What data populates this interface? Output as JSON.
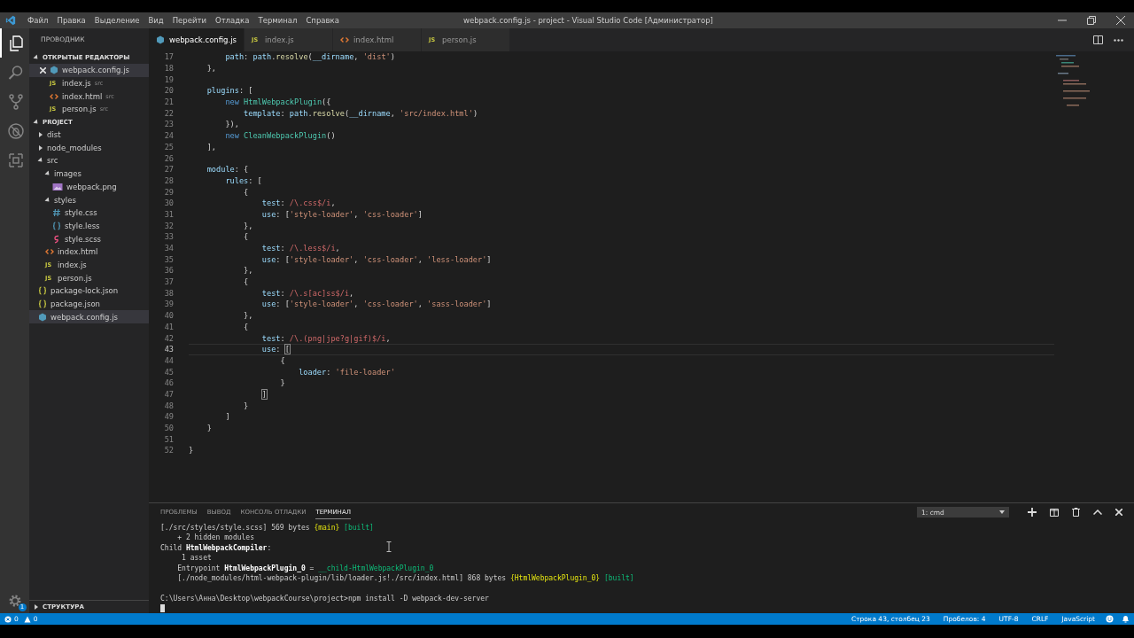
{
  "window": {
    "title": "webpack.config.js - project - Visual Studio Code [Администратор]"
  },
  "menu": [
    "Файл",
    "Правка",
    "Выделение",
    "Вид",
    "Перейти",
    "Отладка",
    "Терминал",
    "Справка"
  ],
  "activity_bar": {
    "items": [
      {
        "kind": "files",
        "selected": true
      },
      {
        "kind": "search",
        "selected": false
      },
      {
        "kind": "source-control",
        "selected": false
      },
      {
        "kind": "debug",
        "selected": false
      },
      {
        "kind": "extensions",
        "selected": false
      }
    ],
    "settings_badge": "1"
  },
  "sidebar": {
    "title": "ПРОВОДНИК",
    "sections": [
      {
        "title": "ОТКРЫТЫЕ РЕДАКТОРЫ",
        "expanded": true,
        "kind": "open-editors",
        "items": [
          {
            "name": "webpack.config.js",
            "kind": "webpack",
            "selected": true
          },
          {
            "name": "index.js",
            "dir": "src",
            "kind": "js",
            "badge": "JS",
            "selected": false
          },
          {
            "name": "index.html",
            "dir": "src",
            "kind": "html",
            "selected": false
          },
          {
            "name": "person.js",
            "dir": "src",
            "kind": "js",
            "badge": "JS",
            "selected": false
          }
        ]
      },
      {
        "title": "PROJECT",
        "expanded": true,
        "kind": "tree",
        "items": [
          {
            "name": "dist",
            "kind": "folder",
            "expanded": false,
            "selected": false
          },
          {
            "name": "node_modules",
            "kind": "folder",
            "expanded": false,
            "selected": false
          },
          {
            "name": "src",
            "kind": "folder",
            "expanded": true,
            "selected": false,
            "children": [
              {
                "name": "images",
                "kind": "folder",
                "expanded": true,
                "selected": false,
                "children": [
                  {
                    "name": "webpack.png",
                    "kind": "image",
                    "selected": false
                  }
                ]
              },
              {
                "name": "styles",
                "kind": "folder",
                "expanded": true,
                "selected": false,
                "children": [
                  {
                    "name": "style.css",
                    "kind": "css",
                    "selected": false
                  },
                  {
                    "name": "style.less",
                    "kind": "less",
                    "selected": false
                  },
                  {
                    "name": "style.scss",
                    "kind": "scss",
                    "selected": false
                  }
                ]
              },
              {
                "name": "index.html",
                "kind": "html",
                "selected": false
              },
              {
                "name": "index.js",
                "kind": "js",
                "badge": "JS",
                "selected": false
              },
              {
                "name": "person.js",
                "kind": "js",
                "badge": "JS",
                "selected": false
              }
            ]
          },
          {
            "name": "package-lock.json",
            "kind": "json",
            "selected": false
          },
          {
            "name": "package.json",
            "kind": "json",
            "selected": false
          },
          {
            "name": "webpack.config.js",
            "kind": "webpack",
            "selected": true
          }
        ]
      },
      {
        "title": "СТРУКТУРА",
        "expanded": false,
        "kind": "outline"
      }
    ]
  },
  "tabs": [
    {
      "label": "webpack.config.js",
      "kind": "webpack",
      "selected": true
    },
    {
      "label": "index.js",
      "kind": "js",
      "badge": "JS",
      "selected": false
    },
    {
      "label": "index.html",
      "kind": "html",
      "selected": false
    },
    {
      "label": "person.js",
      "kind": "js",
      "badge": "JS",
      "selected": false
    }
  ],
  "editor": {
    "lines": [
      {
        "children": [
          {
            "children": [
              {
                "number": "17",
                "current": false,
                "segments": [
                  {
                    "kind": "prop",
                    "text": "path"
                  },
                  {
                    "kind": "plain",
                    "text": ": "
                  },
                  {
                    "kind": "prop",
                    "text": "path"
                  },
                  {
                    "kind": "plain",
                    "text": "."
                  },
                  {
                    "kind": "fn",
                    "text": "resolve"
                  },
                  {
                    "kind": "plain",
                    "text": "("
                  },
                  {
                    "kind": "prop",
                    "text": "__dirname"
                  },
                  {
                    "kind": "plain",
                    "text": ", "
                  },
                  {
                    "kind": "str",
                    "text": "'dist'"
                  },
                  {
                    "kind": "plain",
                    "text": ")"
                  }
                ]
              }
            ]
          },
          {
            "number": "18",
            "current": false,
            "segments": [
              {
                "kind": "plain",
                "text": "},"
              }
            ]
          },
          {
            "number": "19",
            "current": false
          },
          {
            "number": "20",
            "current": false,
            "segments": [
              {
                "kind": "prop",
                "text": "plugins"
              },
              {
                "kind": "plain",
                "text": ": ["
              }
            ],
            "children": [
              {
                "number": "21",
                "current": false,
                "segments": [
                  {
                    "kind": "kw",
                    "text": "new "
                  },
                  {
                    "kind": "cls",
                    "text": "HtmlWebpackPlugin"
                  },
                  {
                    "kind": "plain",
                    "text": "({"
                  }
                ],
                "children": [
                  {
                    "number": "22",
                    "current": false,
                    "segments": [
                      {
                        "kind": "prop",
                        "text": "template"
                      },
                      {
                        "kind": "plain",
                        "text": ": "
                      },
                      {
                        "kind": "prop",
                        "text": "path"
                      },
                      {
                        "kind": "plain",
                        "text": "."
                      },
                      {
                        "kind": "fn",
                        "text": "resolve"
                      },
                      {
                        "kind": "plain",
                        "text": "("
                      },
                      {
                        "kind": "prop",
                        "text": "__dirname"
                      },
                      {
                        "kind": "plain",
                        "text": ", "
                      },
                      {
                        "kind": "str",
                        "text": "'src/index.html'"
                      },
                      {
                        "kind": "plain",
                        "text": ")"
                      }
                    ]
                  }
                ]
              },
              {
                "number": "23",
                "current": false,
                "segments": [
                  {
                    "kind": "plain",
                    "text": "}),"
                  }
                ]
              },
              {
                "number": "24",
                "current": false,
                "segments": [
                  {
                    "kind": "kw",
                    "text": "new "
                  },
                  {
                    "kind": "cls",
                    "text": "CleanWebpackPlugin"
                  },
                  {
                    "kind": "plain",
                    "text": "()"
                  }
                ]
              }
            ]
          },
          {
            "number": "25",
            "current": false,
            "segments": [
              {
                "kind": "plain",
                "text": "],"
              }
            ]
          },
          {
            "number": "26",
            "current": false
          },
          {
            "number": "27",
            "current": false,
            "segments": [
              {
                "kind": "prop",
                "text": "module"
              },
              {
                "kind": "plain",
                "text": ": {"
              }
            ],
            "children": [
              {
                "number": "28",
                "current": false,
                "segments": [
                  {
                    "kind": "prop",
                    "text": "rules"
                  },
                  {
                    "kind": "plain",
                    "text": ": ["
                  }
                ],
                "children": [
                  {
                    "number": "29",
                    "current": false,
                    "segments": [
                      {
                        "kind": "plain",
                        "text": "{"
                      }
                    ],
                    "children": [
                      {
                        "number": "30",
                        "current": false,
                        "segments": [
                          {
                            "kind": "prop",
                            "text": "test"
                          },
                          {
                            "kind": "plain",
                            "text": ": "
                          },
                          {
                            "kind": "re",
                            "text": "/\\.css$/i"
                          },
                          {
                            "kind": "plain",
                            "text": ","
                          }
                        ]
                      },
                      {
                        "number": "31",
                        "current": false,
                        "segments": [
                          {
                            "kind": "prop",
                            "text": "use"
                          },
                          {
                            "kind": "plain",
                            "text": ": ["
                          },
                          {
                            "kind": "str",
                            "text": "'style-loader'"
                          },
                          {
                            "kind": "plain",
                            "text": ", "
                          },
                          {
                            "kind": "str",
                            "text": "'css-loader'"
                          },
                          {
                            "kind": "plain",
                            "text": "]"
                          }
                        ]
                      }
                    ]
                  },
                  {
                    "number": "32",
                    "current": false,
                    "segments": [
                      {
                        "kind": "plain",
                        "text": "},"
                      }
                    ]
                  },
                  {
                    "number": "33",
                    "current": false,
                    "segments": [
                      {
                        "kind": "plain",
                        "text": "{"
                      }
                    ],
                    "children": [
                      {
                        "number": "34",
                        "current": false,
                        "segments": [
                          {
                            "kind": "prop",
                            "text": "test"
                          },
                          {
                            "kind": "plain",
                            "text": ": "
                          },
                          {
                            "kind": "re",
                            "text": "/\\.less$/i"
                          },
                          {
                            "kind": "plain",
                            "text": ","
                          }
                        ]
                      },
                      {
                        "number": "35",
                        "current": false,
                        "segments": [
                          {
                            "kind": "prop",
                            "text": "use"
                          },
                          {
                            "kind": "plain",
                            "text": ": ["
                          },
                          {
                            "kind": "str",
                            "text": "'style-loader'"
                          },
                          {
                            "kind": "plain",
                            "text": ", "
                          },
                          {
                            "kind": "str",
                            "text": "'css-loader'"
                          },
                          {
                            "kind": "plain",
                            "text": ", "
                          },
                          {
                            "kind": "str",
                            "text": "'less-loader'"
                          },
                          {
                            "kind": "plain",
                            "text": "]"
                          }
                        ]
                      }
                    ]
                  },
                  {
                    "number": "36",
                    "current": false,
                    "segments": [
                      {
                        "kind": "plain",
                        "text": "},"
                      }
                    ]
                  },
                  {
                    "number": "37",
                    "current": false,
                    "segments": [
                      {
                        "kind": "plain",
                        "text": "{"
                      }
                    ],
                    "children": [
                      {
                        "number": "38",
                        "current": false,
                        "segments": [
                          {
                            "kind": "prop",
                            "text": "test"
                          },
                          {
                            "kind": "plain",
                            "text": ": "
                          },
                          {
                            "kind": "re",
                            "text": "/\\.s[ac]ss$/i"
                          },
                          {
                            "kind": "plain",
                            "text": ","
                          }
                        ]
                      },
                      {
                        "number": "39",
                        "current": false,
                        "segments": [
                          {
                            "kind": "prop",
                            "text": "use"
                          },
                          {
                            "kind": "plain",
                            "text": ": ["
                          },
                          {
                            "kind": "str",
                            "text": "'style-loader'"
                          },
                          {
                            "kind": "plain",
                            "text": ", "
                          },
                          {
                            "kind": "str",
                            "text": "'css-loader'"
                          },
                          {
                            "kind": "plain",
                            "text": ", "
                          },
                          {
                            "kind": "str",
                            "text": "'sass-loader'"
                          },
                          {
                            "kind": "plain",
                            "text": "]"
                          }
                        ]
                      }
                    ]
                  },
                  {
                    "number": "40",
                    "current": false,
                    "segments": [
                      {
                        "kind": "plain",
                        "text": "},"
                      }
                    ]
                  },
                  {
                    "number": "41",
                    "current": false,
                    "segments": [
                      {
                        "kind": "plain",
                        "text": "{"
                      }
                    ],
                    "children": [
                      {
                        "number": "42",
                        "current": false,
                        "segments": [
                          {
                            "kind": "prop",
                            "text": "test"
                          },
                          {
                            "kind": "plain",
                            "text": ": "
                          },
                          {
                            "kind": "re",
                            "text": "/\\.(png|jpe?g|gif)$/i"
                          },
                          {
                            "kind": "plain",
                            "text": ","
                          }
                        ]
                      },
                      {
                        "number": "43",
                        "current": true,
                        "segments": [
                          {
                            "kind": "prop",
                            "text": "use"
                          },
                          {
                            "kind": "plain",
                            "text": ": "
                          },
                          {
                            "kind": "bracket",
                            "text": "["
                          }
                        ],
                        "children": [
                          {
                            "number": "44",
                            "current": false,
                            "segments": [
                              {
                                "kind": "plain",
                                "text": "{"
                              }
                            ],
                            "children": [
                              {
                                "number": "45",
                                "current": false,
                                "segments": [
                                  {
                                    "kind": "prop",
                                    "text": "loader"
                                  },
                                  {
                                    "kind": "plain",
                                    "text": ": "
                                  },
                                  {
                                    "kind": "str",
                                    "text": "'file-loader'"
                                  }
                                ]
                              }
                            ]
                          },
                          {
                            "number": "46",
                            "current": false,
                            "segments": [
                              {
                                "kind": "plain",
                                "text": "}"
                              }
                            ]
                          }
                        ]
                      },
                      {
                        "number": "47",
                        "current": false,
                        "segments": [
                          {
                            "kind": "bracket",
                            "text": "]"
                          }
                        ]
                      }
                    ]
                  },
                  {
                    "number": "48",
                    "current": false,
                    "segments": [
                      {
                        "kind": "plain",
                        "text": "}"
                      }
                    ]
                  }
                ]
              },
              {
                "number": "49",
                "current": false,
                "segments": [
                  {
                    "kind": "plain",
                    "text": "]"
                  }
                ]
              }
            ]
          },
          {
            "number": "50",
            "current": false,
            "segments": [
              {
                "kind": "plain",
                "text": "}"
              }
            ]
          },
          {
            "number": "51",
            "current": false
          }
        ]
      },
      {
        "number": "52",
        "current": false,
        "segments": [
          {
            "kind": "plain",
            "text": "}"
          }
        ]
      }
    ]
  },
  "panel": {
    "tabs": [
      {
        "label": "ПРОБЛЕМЫ",
        "selected": false
      },
      {
        "label": "ВЫВОД",
        "selected": false
      },
      {
        "label": "КОНСОЛЬ ОТЛАДКИ",
        "selected": false
      },
      {
        "label": "ТЕРМИНАЛ",
        "selected": true
      }
    ],
    "terminal_select": "1: cmd",
    "terminal_lines": [
      {
        "segments": [
          {
            "kind": "plain",
            "text": "[./src/styles/style.scss] 569 bytes "
          },
          {
            "kind": "chunk",
            "text": "{main}"
          },
          {
            "kind": "ok",
            "text": " [built]"
          }
        ]
      },
      {
        "segments": [
          {
            "kind": "plain",
            "text": "    + 2 hidden modules"
          }
        ]
      },
      {
        "segments": [
          {
            "kind": "plain",
            "text": "Child "
          },
          {
            "kind": "bold",
            "text": "HtmlWebpackCompiler"
          },
          {
            "kind": "plain",
            "text": ":"
          }
        ]
      },
      {
        "segments": [
          {
            "kind": "plain",
            "text": "     1 asset"
          }
        ]
      },
      {
        "segments": [
          {
            "kind": "plain",
            "text": "    Entrypoint "
          },
          {
            "kind": "bold",
            "text": "HtmlWebpackPlugin_0"
          },
          {
            "kind": "plain",
            "text": " = "
          },
          {
            "kind": "ok",
            "text": "__child-HtmlWebpackPlugin_0"
          }
        ]
      },
      {
        "segments": [
          {
            "kind": "plain",
            "text": "    [./node_modules/html-webpack-plugin/lib/loader.js!./src/index.html] 868 bytes "
          },
          {
            "kind": "chunk",
            "text": "{HtmlWebpackPlugin_0}"
          },
          {
            "kind": "ok",
            "text": " [built]"
          }
        ]
      },
      {
        "kind": "prompt",
        "segments": [
          {
            "kind": "plain",
            "text": "C:\\Users\\Анна\\Desktop\\webpackCourse\\project>npm install -D webpack-dev-server"
          }
        ]
      }
    ]
  },
  "status_bar": {
    "errors": "0",
    "warnings": "0",
    "items": [
      "Строка 43, столбец 23",
      "Пробелов: 4",
      "UTF-8",
      "CRLF",
      "JavaScript"
    ]
  }
}
